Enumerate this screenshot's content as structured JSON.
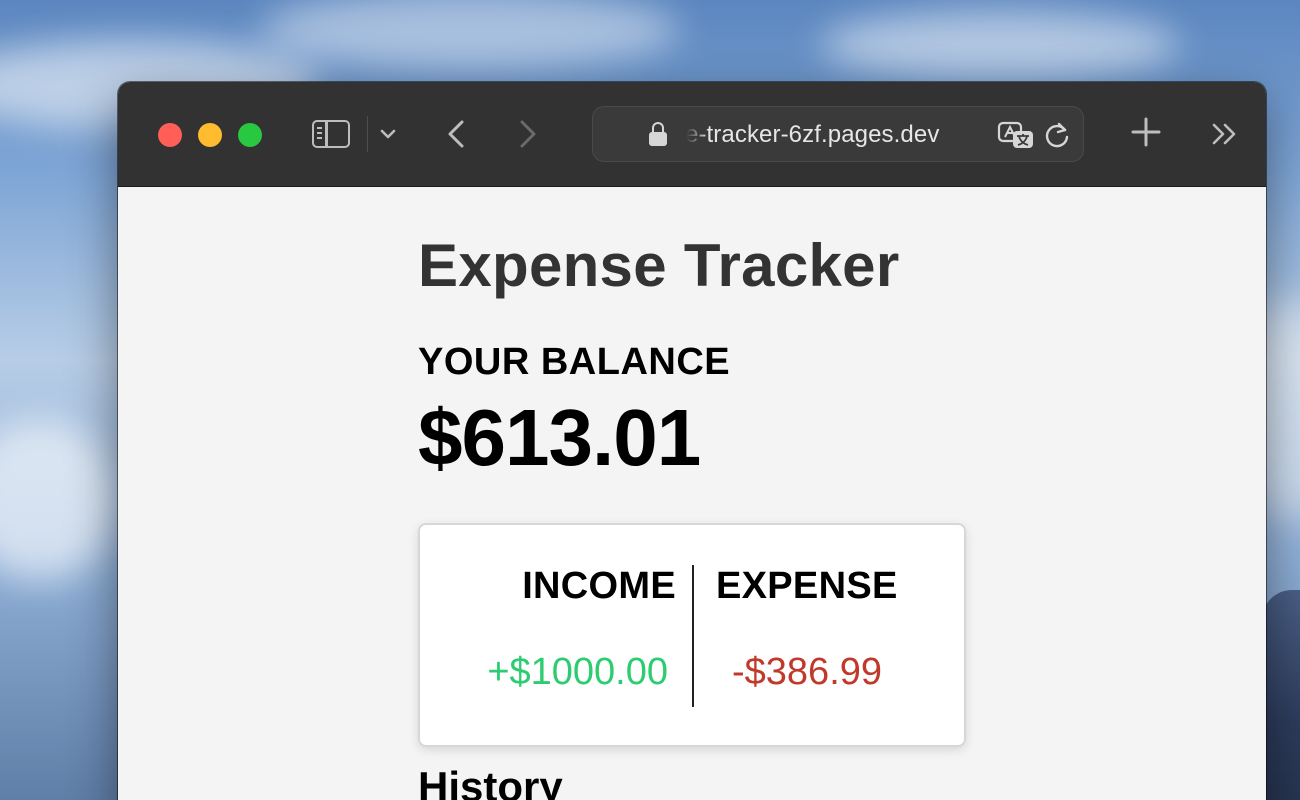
{
  "browser": {
    "url": "e-tracker-6zf.pages.dev",
    "icons": {
      "sidebar": "sidebar-icon",
      "tab_overview": "chevron-down-icon",
      "back": "chevron-left-icon",
      "forward": "chevron-right-icon",
      "lock": "lock-icon",
      "translate": "translate-icon",
      "reload": "reload-icon",
      "new_tab": "plus-icon",
      "more": "double-chevron-right-icon"
    }
  },
  "app": {
    "title": "Expense Tracker",
    "balance_label": "YOUR BALANCE",
    "balance_value": "$613.01",
    "income_label": "INCOME",
    "income_value": "+$1000.00",
    "expense_label": "EXPENSE",
    "expense_value": "-$386.99",
    "history_title": "History"
  },
  "colors": {
    "income": "#2ecc71",
    "expense": "#c0392b",
    "title": "#333333"
  }
}
